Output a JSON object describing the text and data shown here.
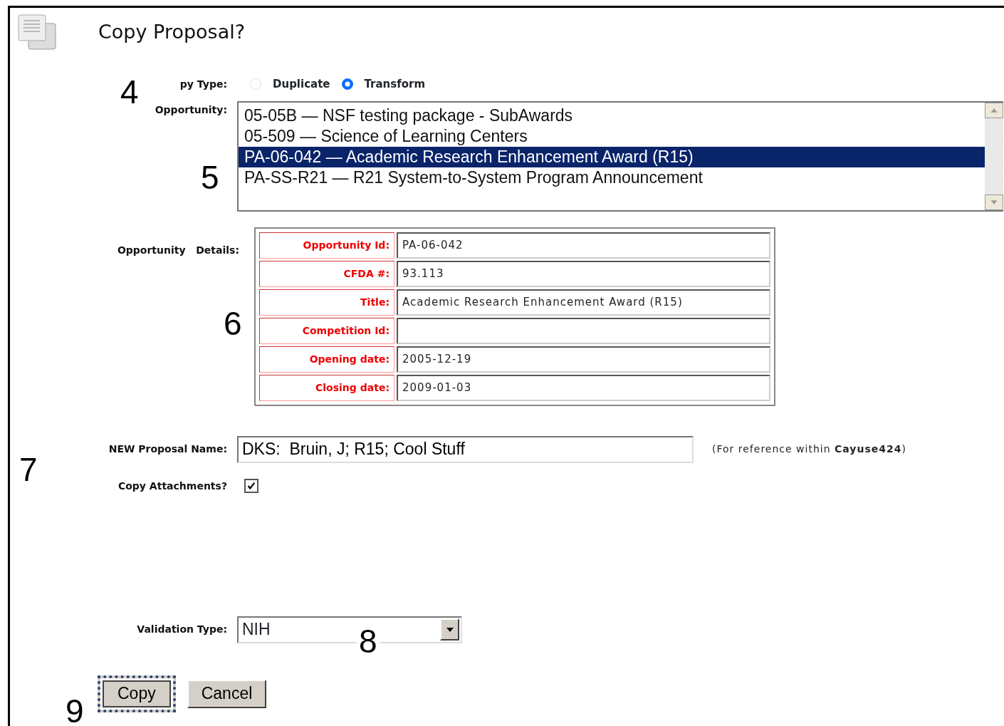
{
  "window": {
    "title": "Copy Proposal?"
  },
  "copy_type": {
    "label": "py Type:",
    "options": [
      {
        "label": "Duplicate",
        "selected": false
      },
      {
        "label": "Transform",
        "selected": true
      }
    ]
  },
  "opportunity": {
    "label": "Opportunity:",
    "items": [
      {
        "text": "05-05B — NSF testing package - SubAwards",
        "selected": false
      },
      {
        "text": "05-509 — Science of Learning Centers",
        "selected": false
      },
      {
        "text": "PA-06-042 — Academic Research Enhancement Award (R15)",
        "selected": true
      },
      {
        "text": "PA-SS-R21 — R21 System-to-System Program Announcement",
        "selected": false
      }
    ]
  },
  "details": {
    "label": "Opportunity   Details:",
    "rows": [
      {
        "label": "Opportunity Id:",
        "value": "PA-06-042"
      },
      {
        "label": "CFDA #:",
        "value": "93.113"
      },
      {
        "label": "Title:",
        "value": "Academic Research Enhancement Award (R15)"
      },
      {
        "label": "Competition Id:"
      },
      {
        "label": "Opening date:",
        "value": "2005-12-19"
      },
      {
        "label": "Closing date:",
        "value": "2009-01-03"
      }
    ]
  },
  "proposal_name": {
    "label": "NEW Proposal Name:",
    "value": "DKS:  Bruin, J; R15; Cool Stuff",
    "note": "(For reference within **Cayuse424**)"
  },
  "copy_attachments": {
    "label": "Copy Attachments?",
    "checked": true
  },
  "validation_type": {
    "label": "Validation Type:",
    "value": "NIH"
  },
  "buttons": [
    {
      "label": "Copy",
      "focused": true
    },
    {
      "label": "Cancel",
      "focused": false
    }
  ],
  "callouts": [
    "4",
    "5",
    "6",
    "7",
    "8",
    "9"
  ]
}
